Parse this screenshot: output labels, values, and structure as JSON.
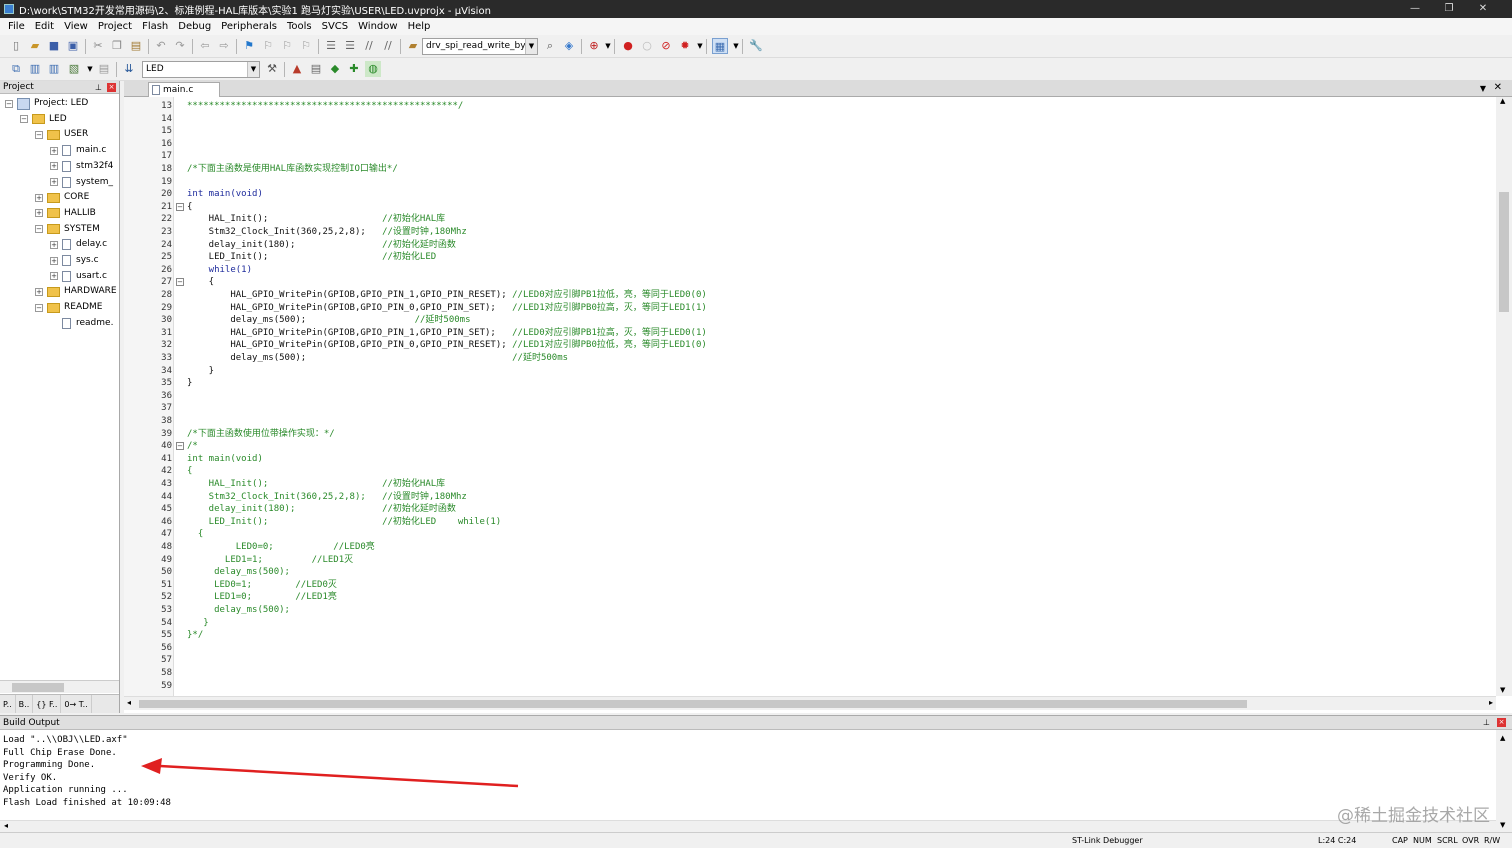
{
  "window": {
    "title": "D:\\work\\STM32开发常用源码\\2、标准例程-HAL库版本\\实验1 跑马灯实验\\USER\\LED.uvprojx - µVision",
    "minimize": "—",
    "restore": "❐",
    "close": "✕"
  },
  "menu": [
    "File",
    "Edit",
    "View",
    "Project",
    "Flash",
    "Debug",
    "Peripherals",
    "Tools",
    "SVCS",
    "Window",
    "Help"
  ],
  "toolbar": {
    "function_combo": "drv_spi_read_write_byte",
    "target_combo": "LED"
  },
  "project_panel": {
    "title": "Project",
    "tree": [
      {
        "label": "Project: LED",
        "kind": "project",
        "depth": 0,
        "toggle": "−"
      },
      {
        "label": "LED",
        "kind": "target",
        "depth": 1,
        "toggle": "−"
      },
      {
        "label": "USER",
        "kind": "folder",
        "depth": 2,
        "toggle": "−"
      },
      {
        "label": "main.c",
        "kind": "file",
        "depth": 3,
        "toggle": "+"
      },
      {
        "label": "stm32f4",
        "kind": "file",
        "depth": 3,
        "toggle": "+"
      },
      {
        "label": "system_",
        "kind": "file",
        "depth": 3,
        "toggle": "+"
      },
      {
        "label": "CORE",
        "kind": "folder",
        "depth": 2,
        "toggle": "+"
      },
      {
        "label": "HALLIB",
        "kind": "folder",
        "depth": 2,
        "toggle": "+"
      },
      {
        "label": "SYSTEM",
        "kind": "folder",
        "depth": 2,
        "toggle": "−"
      },
      {
        "label": "delay.c",
        "kind": "file",
        "depth": 3,
        "toggle": "+"
      },
      {
        "label": "sys.c",
        "kind": "file",
        "depth": 3,
        "toggle": "+"
      },
      {
        "label": "usart.c",
        "kind": "file",
        "depth": 3,
        "toggle": "+"
      },
      {
        "label": "HARDWARE",
        "kind": "folder",
        "depth": 2,
        "toggle": "+"
      },
      {
        "label": "README",
        "kind": "folder",
        "depth": 2,
        "toggle": "−"
      },
      {
        "label": "readme.",
        "kind": "file",
        "depth": 3,
        "toggle": ""
      }
    ],
    "tabs": [
      "P..",
      "B..",
      "{} F..",
      "0→ T.."
    ]
  },
  "editor": {
    "tab": "main.c",
    "lines": [
      {
        "n": "13",
        "t": "**************************************************/",
        "c": "cm"
      },
      {
        "n": "14",
        "t": ""
      },
      {
        "n": "15",
        "t": ""
      },
      {
        "n": "16",
        "t": ""
      },
      {
        "n": "17",
        "t": ""
      },
      {
        "n": "18",
        "t": "/*下面主函数是使用HAL库函数实现控制IO口输出*/",
        "c": "cm"
      },
      {
        "n": "19",
        "t": ""
      },
      {
        "n": "20",
        "t": "int main(void)"
      },
      {
        "n": "21",
        "t": "{",
        "fold": "−"
      },
      {
        "n": "22",
        "t": "    HAL_Init();                     //初始化HAL库"
      },
      {
        "n": "23",
        "t": "    Stm32_Clock_Init(360,25,2,8);   //设置时钟,180Mhz"
      },
      {
        "n": "24",
        "t": "    delay_init(180);                //初始化延时函数"
      },
      {
        "n": "25",
        "t": "    LED_Init();                     //初始化LED"
      },
      {
        "n": "26",
        "t": "    while(1)"
      },
      {
        "n": "27",
        "t": "    {",
        "fold": "−"
      },
      {
        "n": "28",
        "t": "        HAL_GPIO_WritePin(GPIOB,GPIO_PIN_1,GPIO_PIN_RESET); //LED0对应引脚PB1拉低，亮，等同于LED0(0)"
      },
      {
        "n": "29",
        "t": "        HAL_GPIO_WritePin(GPIOB,GPIO_PIN_0,GPIO_PIN_SET);   //LED1对应引脚PB0拉高，灭，等同于LED1(1)"
      },
      {
        "n": "30",
        "t": "        delay_ms(500);                    //延时500ms"
      },
      {
        "n": "31",
        "t": "        HAL_GPIO_WritePin(GPIOB,GPIO_PIN_1,GPIO_PIN_SET);   //LED0对应引脚PB1拉高，灭，等同于LED0(1)"
      },
      {
        "n": "32",
        "t": "        HAL_GPIO_WritePin(GPIOB,GPIO_PIN_0,GPIO_PIN_RESET); //LED1对应引脚PB0拉低，亮，等同于LED1(0)"
      },
      {
        "n": "33",
        "t": "        delay_ms(500);                                      //延时500ms"
      },
      {
        "n": "34",
        "t": "    }"
      },
      {
        "n": "35",
        "t": "}"
      },
      {
        "n": "36",
        "t": ""
      },
      {
        "n": "37",
        "t": ""
      },
      {
        "n": "38",
        "t": ""
      },
      {
        "n": "39",
        "t": "/*下面主函数使用位带操作实现：*/",
        "c": "cm"
      },
      {
        "n": "40",
        "t": "/*",
        "c": "cm",
        "fold": "−"
      },
      {
        "n": "41",
        "t": "int main(void)",
        "c": "cm"
      },
      {
        "n": "42",
        "t": "{",
        "c": "cm"
      },
      {
        "n": "43",
        "t": "    HAL_Init();                     //初始化HAL库",
        "c": "cm"
      },
      {
        "n": "44",
        "t": "    Stm32_Clock_Init(360,25,2,8);   //设置时钟,180Mhz",
        "c": "cm"
      },
      {
        "n": "45",
        "t": "    delay_init(180);                //初始化延时函数",
        "c": "cm"
      },
      {
        "n": "46",
        "t": "    LED_Init();                     //初始化LED    while(1)",
        "c": "cm"
      },
      {
        "n": "47",
        "t": "  {",
        "c": "cm"
      },
      {
        "n": "48",
        "t": "         LED0=0;           //LED0亮",
        "c": "cm"
      },
      {
        "n": "49",
        "t": "       LED1=1;         //LED1灭",
        "c": "cm"
      },
      {
        "n": "50",
        "t": "     delay_ms(500);",
        "c": "cm"
      },
      {
        "n": "51",
        "t": "     LED0=1;        //LED0灭",
        "c": "cm"
      },
      {
        "n": "52",
        "t": "     LED1=0;        //LED1亮",
        "c": "cm"
      },
      {
        "n": "53",
        "t": "     delay_ms(500);",
        "c": "cm"
      },
      {
        "n": "54",
        "t": "   }",
        "c": "cm"
      },
      {
        "n": "55",
        "t": "}*/",
        "c": "cm"
      },
      {
        "n": "56",
        "t": ""
      },
      {
        "n": "57",
        "t": ""
      },
      {
        "n": "58",
        "t": ""
      },
      {
        "n": "59",
        "t": ""
      }
    ]
  },
  "build_output": {
    "title": "Build Output",
    "lines": [
      "Load \"..\\\\OBJ\\\\LED.axf\"",
      "Full Chip Erase Done.",
      "Programming Done.",
      "Verify OK.",
      "Application running ...",
      "Flash Load finished at 10:09:48"
    ]
  },
  "status": {
    "debugger": "ST-Link Debugger",
    "position": "L:24 C:24",
    "cap": "CAP",
    "num": "NUM",
    "scrl": "SCRL",
    "ovr": "OVR",
    "rw": "R/W"
  },
  "watermark": "@稀土掘金技术社区",
  "colors": {
    "comment": "#2a8a2a",
    "keyword": "#1e2b9c",
    "arrow": "#e02020",
    "titlebar": "#2a2a2a"
  }
}
